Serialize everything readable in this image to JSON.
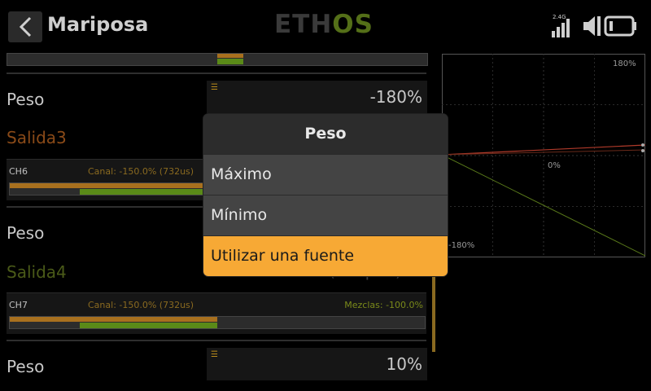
{
  "header": {
    "title": "Mariposa",
    "logo_a": "ETH",
    "logo_b": "OS",
    "rf_band": "2.4G"
  },
  "rows": [
    {
      "label": "Peso",
      "value": "-180%"
    },
    {
      "label": "Peso",
      "value": ""
    },
    {
      "label": "Peso",
      "value": "10%"
    }
  ],
  "outputs": [
    {
      "name": "Salida3",
      "color": "#8a4a18",
      "channel": "CH6",
      "canal": "Canal: -150.0% (732us)",
      "mezclas": "",
      "value_text": ""
    },
    {
      "name": "Salida4",
      "color": "#4a5a18",
      "channel": "CH7",
      "canal": "Canal: -150.0% (732us)",
      "mezclas": "Mezclas: -100.0%",
      "value_text": "CH7 (-Mapeo)"
    }
  ],
  "chart": {
    "top_label": "180%",
    "mid_label": "0%",
    "bottom_label": "-180%"
  },
  "modal": {
    "title": "Peso",
    "options": [
      "Máximo",
      "Mínimo",
      "Utilizar una fuente"
    ],
    "selected_index": 2
  },
  "colors": {
    "accent": "#f7a935",
    "orange_bar": "#a8701e",
    "green_bar": "#5a8a18"
  }
}
